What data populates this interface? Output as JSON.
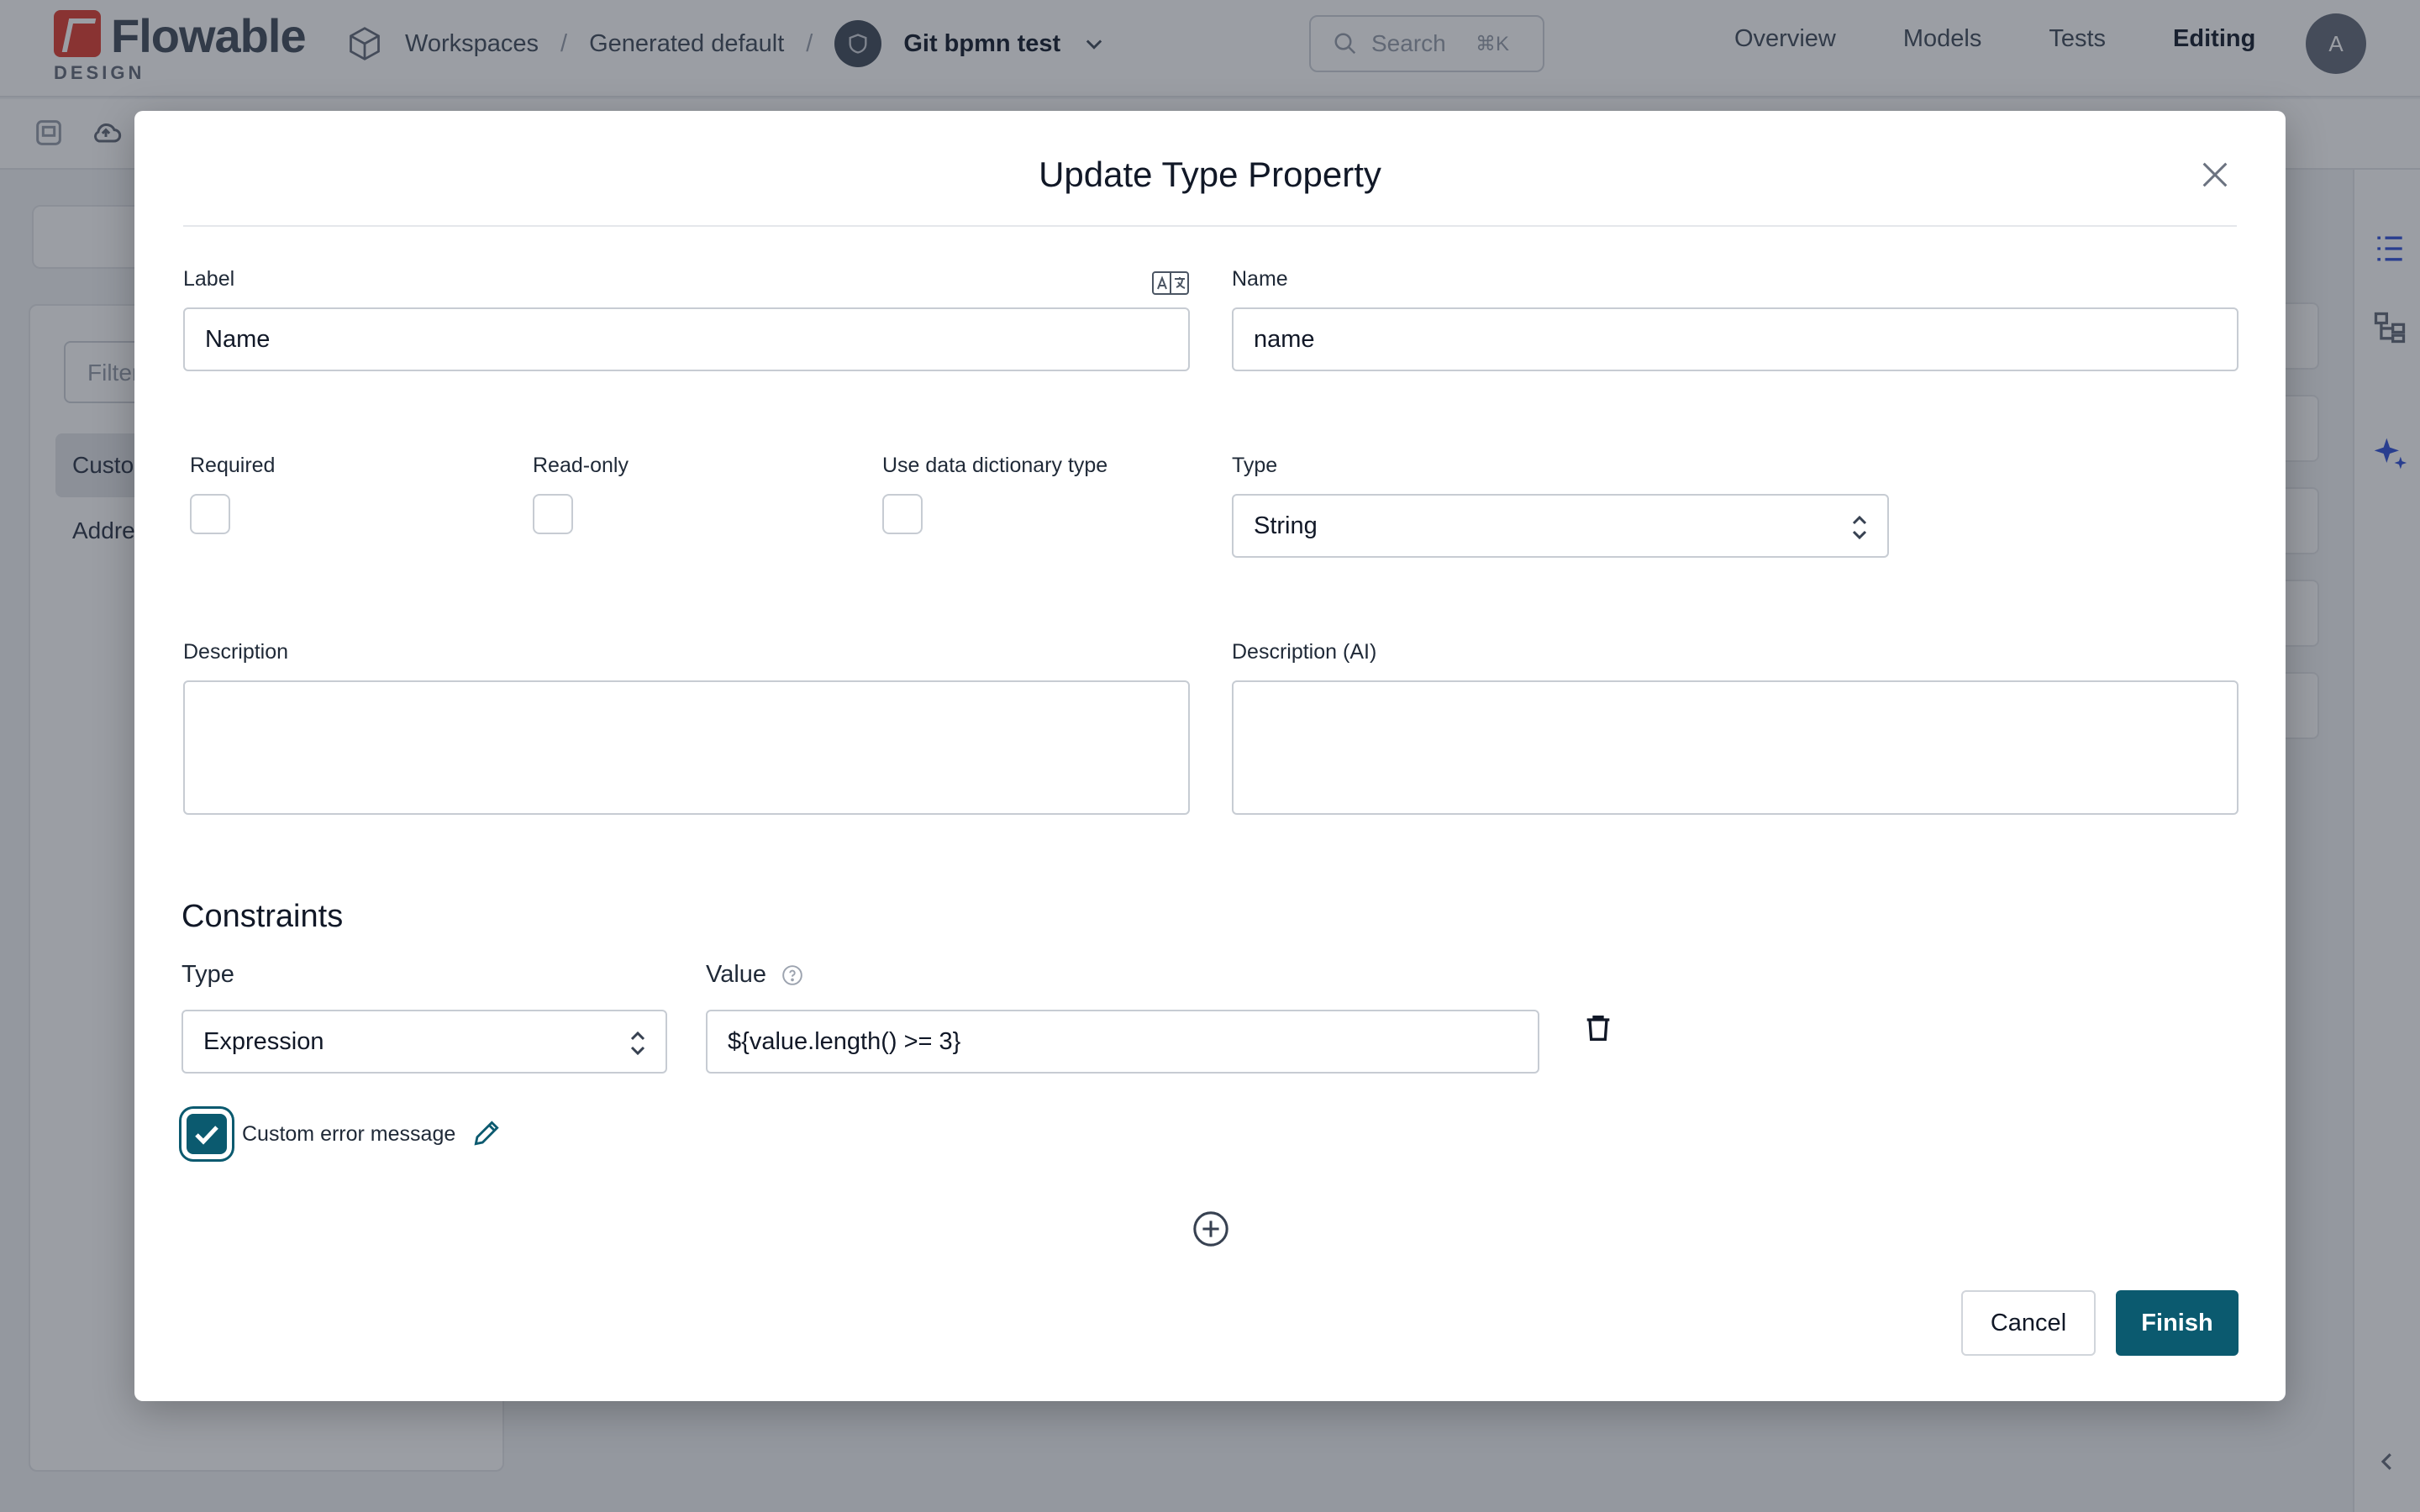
{
  "header": {
    "brand": "Flowable",
    "brand_sub": "DESIGN",
    "breadcrumb": [
      "Workspaces",
      "Generated default",
      "Git bpmn test"
    ],
    "breadcrumb_separator": "/",
    "search_placeholder": "Search",
    "search_shortcut": "⌘K",
    "nav": [
      "Overview",
      "Models",
      "Tests",
      "Editing"
    ],
    "active_nav": "Editing",
    "avatar_initial": "A"
  },
  "background": {
    "filter_placeholder": "Filter",
    "list_items": [
      "Customer",
      "Address"
    ]
  },
  "modal": {
    "title": "Update Type Property",
    "label_field": {
      "label": "Label",
      "value": "Name"
    },
    "name_field": {
      "label": "Name",
      "value": "name"
    },
    "required_label": "Required",
    "required_checked": false,
    "readonly_label": "Read-only",
    "readonly_checked": false,
    "dictionary_label": "Use data dictionary type",
    "dictionary_checked": false,
    "type_field": {
      "label": "Type",
      "value": "String"
    },
    "description_label": "Description",
    "description_value": "",
    "description_ai_label": "Description (AI)",
    "description_ai_value": "",
    "constraints": {
      "title": "Constraints",
      "type_label": "Type",
      "value_label": "Value",
      "rows": [
        {
          "type": "Expression",
          "value": "${value.length() >= 3}"
        }
      ],
      "custom_error_label": "Custom error message",
      "custom_error_checked": true
    },
    "cancel_label": "Cancel",
    "finish_label": "Finish"
  },
  "colors": {
    "primary": "#0b5a6f",
    "brand_red": "#e0473c",
    "ai_accent": "#3b5bdb"
  }
}
